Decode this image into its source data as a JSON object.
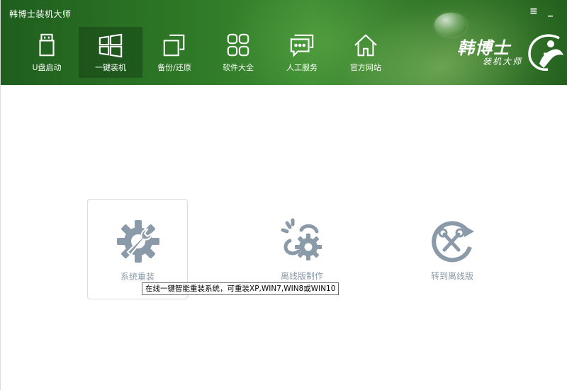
{
  "window": {
    "title": "韩博士装机大师"
  },
  "nav": {
    "items": [
      {
        "label": "U盘启动",
        "icon": "usb-drive-icon"
      },
      {
        "label": "一键装机",
        "icon": "windows-icon",
        "active": true
      },
      {
        "label": "备份/还原",
        "icon": "copy-icon"
      },
      {
        "label": "软件大全",
        "icon": "apps-grid-icon"
      },
      {
        "label": "人工服务",
        "icon": "chat-icon"
      },
      {
        "label": "官方网站",
        "icon": "home-icon"
      }
    ]
  },
  "brand": {
    "main": "韩博士",
    "sub": "装机大师"
  },
  "features": [
    {
      "label": "系统重装",
      "icon": "gear-wrench-icon"
    },
    {
      "label": "离线版制作",
      "icon": "link-gear-icon"
    },
    {
      "label": "转到离线版",
      "icon": "tools-refresh-icon"
    }
  ],
  "tooltip": {
    "text": "在线一键智能重装系统，可重装XP,WIN7,WIN8或WIN10"
  },
  "colors": {
    "header_green": "#2f7a27",
    "icon_gray": "#8a9aa8",
    "text_white": "#ffffff"
  }
}
